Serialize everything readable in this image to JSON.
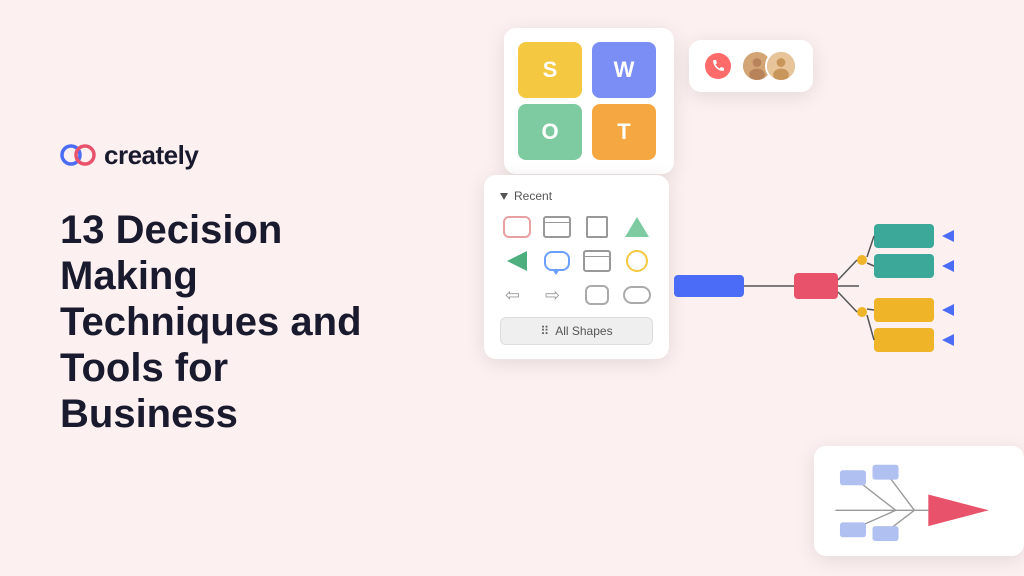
{
  "brand": {
    "logo_text": "creately",
    "logo_icon": "∞"
  },
  "headline": {
    "line1": "13 Decision",
    "line2": "Making",
    "line3": "Techniques and",
    "line4": "Tools for",
    "line5": "Business"
  },
  "swot": {
    "s": "S",
    "w": "W",
    "o": "O",
    "t": "T"
  },
  "panel": {
    "header": "Recent",
    "all_shapes_label": "All Shapes",
    "all_shapes_icon": "⠿"
  },
  "colors": {
    "background": "#fdf0f0",
    "brand_dark": "#1a1a2e",
    "accent_red": "#ff6b6b",
    "decision_blue": "#4a6cf7",
    "decision_red": "#e8526a",
    "decision_teal": "#3ba899",
    "decision_yellow": "#f0b429",
    "swot_s": "#f5c842",
    "swot_w": "#7b8ef5",
    "swot_o": "#7ecba1",
    "swot_t": "#f5a842"
  }
}
